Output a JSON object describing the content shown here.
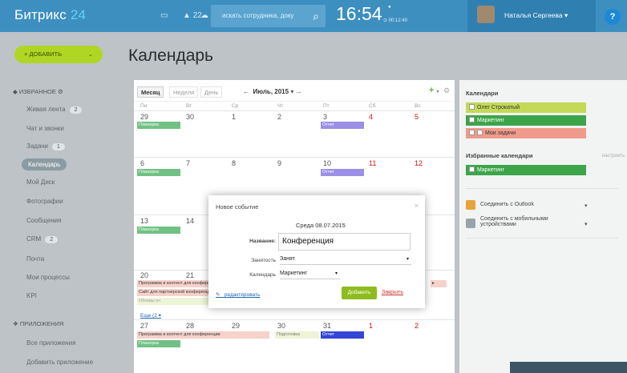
{
  "topbar": {
    "logo_a": "Битрикс",
    "logo_b": "24",
    "notif_count": "22",
    "search_placeholder": "искать сотрудника, доку",
    "clock": "16:54",
    "clock_small": "00:12:40",
    "user_name": "Наталья Сергеева",
    "help": "?"
  },
  "sidebar": {
    "add_button": "+ ДОБАВИТЬ",
    "favorites_header": "ИЗБРАННОЕ",
    "items": [
      {
        "label": "Живая лента",
        "badge": "2"
      },
      {
        "label": "Чат и звонки"
      },
      {
        "label": "Задачи",
        "badge": "1"
      },
      {
        "label": "Календарь"
      },
      {
        "label": "Мой Диск"
      },
      {
        "label": "Фотографии"
      },
      {
        "label": "Сообщения"
      },
      {
        "label": "CRM",
        "badge": "2"
      },
      {
        "label": "Почта"
      },
      {
        "label": "Мои процессы"
      },
      {
        "label": "KPI"
      }
    ],
    "apps_header": "ПРИЛОЖЕНИЯ",
    "apps": [
      "Все приложения",
      "Добавить приложение"
    ]
  },
  "page_title": "Календарь",
  "calendar": {
    "views": [
      "Месяц",
      "Неделя",
      "День"
    ],
    "month_label": "Июль, 2015",
    "weekdays": [
      "Пн",
      "Вт",
      "Ср",
      "Чт",
      "Пт",
      "Сб",
      "Вс"
    ],
    "weeks": [
      [
        "29",
        "30",
        "1",
        "2",
        "3",
        "4",
        "5"
      ],
      [
        "6",
        "7",
        "8",
        "9",
        "10",
        "11",
        "12"
      ],
      [
        "13",
        "14"
      ],
      [
        "20",
        "21"
      ],
      [
        "27",
        "28",
        "29",
        "30",
        "31",
        "1",
        "2"
      ]
    ],
    "events": {
      "planning": "Планерка",
      "report": "Отчет",
      "program": "Программа и контент для конференции",
      "site": "Сайт для партнерской конференции",
      "review": "Обзоры уч",
      "prep": "Подготовка",
      "more": "Еще (2"
    }
  },
  "right_panel": {
    "calendars_title": "Календари",
    "calendars": [
      {
        "name": "Олег Строкатый",
        "color": "#c4d957"
      },
      {
        "name": "Маркетинг",
        "color": "#3ca54a"
      },
      {
        "name": "Мои задачи",
        "color": "#ef9a8a"
      }
    ],
    "favorites_title": "Избранные календари",
    "favorites_setup": "настроить",
    "favorites": [
      {
        "name": "Маркетинг",
        "color": "#3ca54a"
      }
    ],
    "outlook": "Соединить с Outlook",
    "mobile": "Соединить с мобильными устройствами"
  },
  "modal": {
    "title": "Новое событие",
    "date": "Среда 08.07.2015",
    "name_label": "Название:",
    "name_value": "Конференция",
    "busy_label": "Занятость",
    "busy_value": "Занят",
    "calendar_label": "Календарь",
    "calendar_value": "Маркетинг",
    "edit_link": "редактировать",
    "add_button": "Добавить",
    "cancel_link": "Закрыть"
  },
  "colors": {
    "topbar": "#3d8fc0",
    "green_event": "#72c184",
    "purple_event": "#9b8fe6",
    "blue_event": "#3346d6"
  }
}
